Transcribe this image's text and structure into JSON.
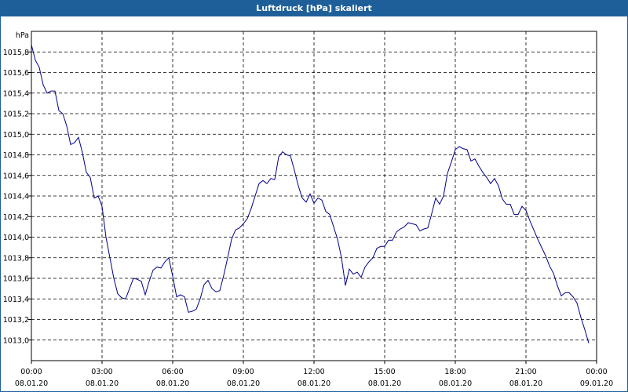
{
  "window": {
    "title": "Luftdruck [hPa] skaliert"
  },
  "chart_data": {
    "type": "line",
    "title": "Luftdruck [hPa] skaliert",
    "unit": "hPa",
    "xlim": [
      "2020-01-08T00:00",
      "2020-01-09T00:00"
    ],
    "ylim": [
      1012.8,
      1016.0
    ],
    "y_ticks": [
      "1013,0",
      "1013,2",
      "1013,4",
      "1013,6",
      "1013,8",
      "1014,0",
      "1014,2",
      "1014,4",
      "1014,6",
      "1014,8",
      "1015,0",
      "1015,2",
      "1015,4",
      "1015,6",
      "1015,8"
    ],
    "x_ticks": [
      {
        "time": "00:00",
        "date": "08.01.20"
      },
      {
        "time": "03:00",
        "date": "08.01.20"
      },
      {
        "time": "06:00",
        "date": "08.01.20"
      },
      {
        "time": "09:00",
        "date": "08.01.20"
      },
      {
        "time": "12:00",
        "date": "08.01.20"
      },
      {
        "time": "15:00",
        "date": "08.01.20"
      },
      {
        "time": "18:00",
        "date": "08.01.20"
      },
      {
        "time": "21:00",
        "date": "08.01.20"
      },
      {
        "time": "00:00",
        "date": "09.01.20"
      }
    ],
    "grid": true,
    "line_color": "#00008b",
    "series": [
      {
        "name": "",
        "points": [
          [
            "2020-01-08T00:00",
            1015.87
          ],
          [
            "2020-01-08T00:10",
            1015.72
          ],
          [
            "2020-01-08T00:20",
            1015.65
          ],
          [
            "2020-01-08T00:30",
            1015.48
          ],
          [
            "2020-01-08T00:40",
            1015.4
          ],
          [
            "2020-01-08T00:50",
            1015.42
          ],
          [
            "2020-01-08T01:00",
            1015.42
          ],
          [
            "2020-01-08T01:10",
            1015.23
          ],
          [
            "2020-01-08T01:20",
            1015.2
          ],
          [
            "2020-01-08T01:30",
            1015.08
          ],
          [
            "2020-01-08T01:40",
            1014.9
          ],
          [
            "2020-01-08T01:50",
            1014.92
          ],
          [
            "2020-01-08T02:00",
            1014.97
          ],
          [
            "2020-01-08T02:10",
            1014.82
          ],
          [
            "2020-01-08T02:20",
            1014.63
          ],
          [
            "2020-01-08T02:30",
            1014.58
          ],
          [
            "2020-01-08T02:40",
            1014.38
          ],
          [
            "2020-01-08T02:50",
            1014.4
          ],
          [
            "2020-01-08T03:00",
            1014.3
          ],
          [
            "2020-01-08T03:10",
            1014.0
          ],
          [
            "2020-01-08T03:20",
            1013.8
          ],
          [
            "2020-01-08T03:30",
            1013.6
          ],
          [
            "2020-01-08T03:40",
            1013.45
          ],
          [
            "2020-01-08T03:50",
            1013.41
          ],
          [
            "2020-01-08T04:00",
            1013.4
          ],
          [
            "2020-01-08T04:10",
            1013.5
          ],
          [
            "2020-01-08T04:20",
            1013.6
          ],
          [
            "2020-01-08T04:30",
            1013.59
          ],
          [
            "2020-01-08T04:40",
            1013.57
          ],
          [
            "2020-01-08T04:50",
            1013.44
          ],
          [
            "2020-01-08T05:00",
            1013.57
          ],
          [
            "2020-01-08T05:10",
            1013.68
          ],
          [
            "2020-01-08T05:20",
            1013.71
          ],
          [
            "2020-01-08T05:30",
            1013.7
          ],
          [
            "2020-01-08T05:40",
            1013.76
          ],
          [
            "2020-01-08T05:50",
            1013.8
          ],
          [
            "2020-01-08T06:00",
            1013.62
          ],
          [
            "2020-01-08T06:10",
            1013.42
          ],
          [
            "2020-01-08T06:20",
            1013.44
          ],
          [
            "2020-01-08T06:30",
            1013.42
          ],
          [
            "2020-01-08T06:40",
            1013.27
          ],
          [
            "2020-01-08T06:50",
            1013.28
          ],
          [
            "2020-01-08T07:00",
            1013.3
          ],
          [
            "2020-01-08T07:10",
            1013.4
          ],
          [
            "2020-01-08T07:20",
            1013.54
          ],
          [
            "2020-01-08T07:30",
            1013.58
          ],
          [
            "2020-01-08T07:40",
            1013.5
          ],
          [
            "2020-01-08T07:50",
            1013.47
          ],
          [
            "2020-01-08T08:00",
            1013.48
          ],
          [
            "2020-01-08T08:10",
            1013.63
          ],
          [
            "2020-01-08T08:20",
            1013.8
          ],
          [
            "2020-01-08T08:30",
            1013.98
          ],
          [
            "2020-01-08T08:40",
            1014.07
          ],
          [
            "2020-01-08T08:50",
            1014.09
          ],
          [
            "2020-01-08T09:00",
            1014.13
          ],
          [
            "2020-01-08T09:10",
            1014.18
          ],
          [
            "2020-01-08T09:20",
            1014.28
          ],
          [
            "2020-01-08T09:30",
            1014.4
          ],
          [
            "2020-01-08T09:40",
            1014.52
          ],
          [
            "2020-01-08T09:50",
            1014.55
          ],
          [
            "2020-01-08T10:00",
            1014.52
          ],
          [
            "2020-01-08T10:10",
            1014.57
          ],
          [
            "2020-01-08T10:20",
            1014.56
          ],
          [
            "2020-01-08T10:30",
            1014.78
          ],
          [
            "2020-01-08T10:40",
            1014.83
          ],
          [
            "2020-01-08T10:50",
            1014.8
          ],
          [
            "2020-01-08T11:00",
            1014.79
          ],
          [
            "2020-01-08T11:10",
            1014.65
          ],
          [
            "2020-01-08T11:20",
            1014.5
          ],
          [
            "2020-01-08T11:30",
            1014.38
          ],
          [
            "2020-01-08T11:40",
            1014.34
          ],
          [
            "2020-01-08T11:50",
            1014.42
          ],
          [
            "2020-01-08T12:00",
            1014.33
          ],
          [
            "2020-01-08T12:10",
            1014.38
          ],
          [
            "2020-01-08T12:20",
            1014.36
          ],
          [
            "2020-01-08T12:30",
            1014.25
          ],
          [
            "2020-01-08T12:40",
            1014.22
          ],
          [
            "2020-01-08T12:50",
            1014.1
          ],
          [
            "2020-01-08T13:00",
            1013.98
          ],
          [
            "2020-01-08T13:10",
            1013.8
          ],
          [
            "2020-01-08T13:20",
            1013.53
          ],
          [
            "2020-01-08T13:30",
            1013.69
          ],
          [
            "2020-01-08T13:40",
            1013.64
          ],
          [
            "2020-01-08T13:50",
            1013.66
          ],
          [
            "2020-01-08T14:00",
            1013.61
          ],
          [
            "2020-01-08T14:10",
            1013.71
          ],
          [
            "2020-01-08T14:20",
            1013.76
          ],
          [
            "2020-01-08T14:30",
            1013.8
          ],
          [
            "2020-01-08T14:40",
            1013.89
          ],
          [
            "2020-01-08T14:50",
            1013.91
          ],
          [
            "2020-01-08T15:00",
            1013.91
          ],
          [
            "2020-01-08T15:10",
            1013.97
          ],
          [
            "2020-01-08T15:20",
            1013.97
          ],
          [
            "2020-01-08T15:30",
            1014.05
          ],
          [
            "2020-01-08T15:40",
            1014.08
          ],
          [
            "2020-01-08T15:50",
            1014.1
          ],
          [
            "2020-01-08T16:00",
            1014.14
          ],
          [
            "2020-01-08T16:10",
            1014.13
          ],
          [
            "2020-01-08T16:20",
            1014.12
          ],
          [
            "2020-01-08T16:30",
            1014.06
          ],
          [
            "2020-01-08T16:40",
            1014.08
          ],
          [
            "2020-01-08T16:50",
            1014.09
          ],
          [
            "2020-01-08T17:00",
            1014.23
          ],
          [
            "2020-01-08T17:10",
            1014.38
          ],
          [
            "2020-01-08T17:20",
            1014.32
          ],
          [
            "2020-01-08T17:30",
            1014.4
          ],
          [
            "2020-01-08T17:40",
            1014.62
          ],
          [
            "2020-01-08T17:50",
            1014.73
          ],
          [
            "2020-01-08T18:00",
            1014.85
          ],
          [
            "2020-01-08T18:10",
            1014.88
          ],
          [
            "2020-01-08T18:20",
            1014.86
          ],
          [
            "2020-01-08T18:30",
            1014.85
          ],
          [
            "2020-01-08T18:40",
            1014.74
          ],
          [
            "2020-01-08T18:50",
            1014.76
          ],
          [
            "2020-01-08T19:00",
            1014.69
          ],
          [
            "2020-01-08T19:10",
            1014.63
          ],
          [
            "2020-01-08T19:20",
            1014.58
          ],
          [
            "2020-01-08T19:30",
            1014.52
          ],
          [
            "2020-01-08T19:40",
            1014.57
          ],
          [
            "2020-01-08T19:50",
            1014.5
          ],
          [
            "2020-01-08T20:00",
            1014.37
          ],
          [
            "2020-01-08T20:10",
            1014.32
          ],
          [
            "2020-01-08T20:20",
            1014.32
          ],
          [
            "2020-01-08T20:30",
            1014.22
          ],
          [
            "2020-01-08T20:40",
            1014.22
          ],
          [
            "2020-01-08T20:50",
            1014.3
          ],
          [
            "2020-01-08T21:00",
            1014.26
          ],
          [
            "2020-01-08T21:10",
            1014.16
          ],
          [
            "2020-01-08T21:20",
            1014.07
          ],
          [
            "2020-01-08T21:30",
            1013.98
          ],
          [
            "2020-01-08T21:40",
            1013.9
          ],
          [
            "2020-01-08T21:50",
            1013.82
          ],
          [
            "2020-01-08T22:00",
            1013.72
          ],
          [
            "2020-01-08T22:10",
            1013.65
          ],
          [
            "2020-01-08T22:20",
            1013.53
          ],
          [
            "2020-01-08T22:30",
            1013.43
          ],
          [
            "2020-01-08T22:40",
            1013.46
          ],
          [
            "2020-01-08T22:50",
            1013.46
          ],
          [
            "2020-01-08T23:00",
            1013.42
          ],
          [
            "2020-01-08T23:10",
            1013.36
          ],
          [
            "2020-01-08T23:20",
            1013.22
          ],
          [
            "2020-01-08T23:30",
            1013.1
          ],
          [
            "2020-01-08T23:40",
            1012.97
          ]
        ]
      }
    ]
  }
}
